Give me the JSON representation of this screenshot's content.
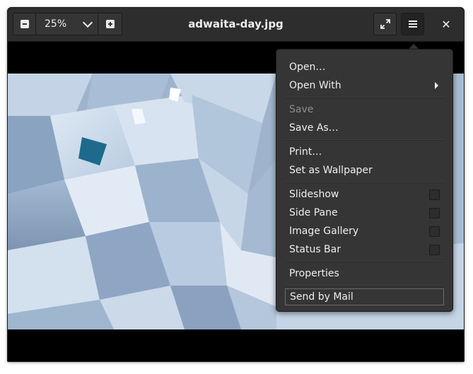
{
  "headerbar": {
    "title": "adwaita-day.jpg",
    "zoom_value": "25%",
    "icons": {
      "zoom_out": "zoom-out-icon",
      "zoom_in": "zoom-in-icon",
      "dropdown": "chevron-down-icon",
      "fullscreen": "fullscreen-icon",
      "menu": "hamburger-menu-icon",
      "close": "close-icon"
    },
    "close_glyph": "✕"
  },
  "menu": {
    "items": [
      {
        "label": "Open…"
      },
      {
        "label": "Open With"
      },
      {
        "label": "Save"
      },
      {
        "label": "Save As…"
      },
      {
        "label": "Print…"
      },
      {
        "label": "Set as Wallpaper"
      },
      {
        "label": "Slideshow"
      },
      {
        "label": "Side Pane"
      },
      {
        "label": "Image Gallery"
      },
      {
        "label": "Status Bar"
      },
      {
        "label": "Properties"
      },
      {
        "label": "Send by Mail"
      }
    ]
  },
  "colors": {
    "headerbar_bg": "#2d2d2d",
    "popover_bg": "#353535",
    "text": "#eeeeec",
    "disabled_text": "#8b8e8f"
  }
}
